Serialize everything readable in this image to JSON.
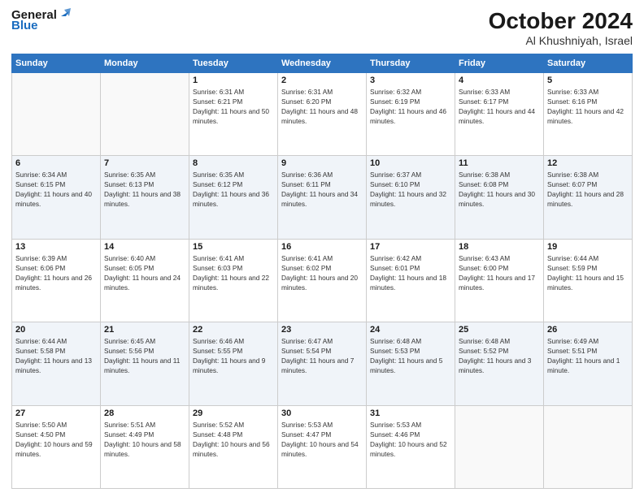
{
  "header": {
    "logo_general": "General",
    "logo_blue": "Blue",
    "month_title": "October 2024",
    "location": "Al Khushniyah, Israel"
  },
  "weekdays": [
    "Sunday",
    "Monday",
    "Tuesday",
    "Wednesday",
    "Thursday",
    "Friday",
    "Saturday"
  ],
  "weeks": [
    [
      {
        "day": "",
        "sunrise": "",
        "sunset": "",
        "daylight": ""
      },
      {
        "day": "",
        "sunrise": "",
        "sunset": "",
        "daylight": ""
      },
      {
        "day": "1",
        "sunrise": "Sunrise: 6:31 AM",
        "sunset": "Sunset: 6:21 PM",
        "daylight": "Daylight: 11 hours and 50 minutes."
      },
      {
        "day": "2",
        "sunrise": "Sunrise: 6:31 AM",
        "sunset": "Sunset: 6:20 PM",
        "daylight": "Daylight: 11 hours and 48 minutes."
      },
      {
        "day": "3",
        "sunrise": "Sunrise: 6:32 AM",
        "sunset": "Sunset: 6:19 PM",
        "daylight": "Daylight: 11 hours and 46 minutes."
      },
      {
        "day": "4",
        "sunrise": "Sunrise: 6:33 AM",
        "sunset": "Sunset: 6:17 PM",
        "daylight": "Daylight: 11 hours and 44 minutes."
      },
      {
        "day": "5",
        "sunrise": "Sunrise: 6:33 AM",
        "sunset": "Sunset: 6:16 PM",
        "daylight": "Daylight: 11 hours and 42 minutes."
      }
    ],
    [
      {
        "day": "6",
        "sunrise": "Sunrise: 6:34 AM",
        "sunset": "Sunset: 6:15 PM",
        "daylight": "Daylight: 11 hours and 40 minutes."
      },
      {
        "day": "7",
        "sunrise": "Sunrise: 6:35 AM",
        "sunset": "Sunset: 6:13 PM",
        "daylight": "Daylight: 11 hours and 38 minutes."
      },
      {
        "day": "8",
        "sunrise": "Sunrise: 6:35 AM",
        "sunset": "Sunset: 6:12 PM",
        "daylight": "Daylight: 11 hours and 36 minutes."
      },
      {
        "day": "9",
        "sunrise": "Sunrise: 6:36 AM",
        "sunset": "Sunset: 6:11 PM",
        "daylight": "Daylight: 11 hours and 34 minutes."
      },
      {
        "day": "10",
        "sunrise": "Sunrise: 6:37 AM",
        "sunset": "Sunset: 6:10 PM",
        "daylight": "Daylight: 11 hours and 32 minutes."
      },
      {
        "day": "11",
        "sunrise": "Sunrise: 6:38 AM",
        "sunset": "Sunset: 6:08 PM",
        "daylight": "Daylight: 11 hours and 30 minutes."
      },
      {
        "day": "12",
        "sunrise": "Sunrise: 6:38 AM",
        "sunset": "Sunset: 6:07 PM",
        "daylight": "Daylight: 11 hours and 28 minutes."
      }
    ],
    [
      {
        "day": "13",
        "sunrise": "Sunrise: 6:39 AM",
        "sunset": "Sunset: 6:06 PM",
        "daylight": "Daylight: 11 hours and 26 minutes."
      },
      {
        "day": "14",
        "sunrise": "Sunrise: 6:40 AM",
        "sunset": "Sunset: 6:05 PM",
        "daylight": "Daylight: 11 hours and 24 minutes."
      },
      {
        "day": "15",
        "sunrise": "Sunrise: 6:41 AM",
        "sunset": "Sunset: 6:03 PM",
        "daylight": "Daylight: 11 hours and 22 minutes."
      },
      {
        "day": "16",
        "sunrise": "Sunrise: 6:41 AM",
        "sunset": "Sunset: 6:02 PM",
        "daylight": "Daylight: 11 hours and 20 minutes."
      },
      {
        "day": "17",
        "sunrise": "Sunrise: 6:42 AM",
        "sunset": "Sunset: 6:01 PM",
        "daylight": "Daylight: 11 hours and 18 minutes."
      },
      {
        "day": "18",
        "sunrise": "Sunrise: 6:43 AM",
        "sunset": "Sunset: 6:00 PM",
        "daylight": "Daylight: 11 hours and 17 minutes."
      },
      {
        "day": "19",
        "sunrise": "Sunrise: 6:44 AM",
        "sunset": "Sunset: 5:59 PM",
        "daylight": "Daylight: 11 hours and 15 minutes."
      }
    ],
    [
      {
        "day": "20",
        "sunrise": "Sunrise: 6:44 AM",
        "sunset": "Sunset: 5:58 PM",
        "daylight": "Daylight: 11 hours and 13 minutes."
      },
      {
        "day": "21",
        "sunrise": "Sunrise: 6:45 AM",
        "sunset": "Sunset: 5:56 PM",
        "daylight": "Daylight: 11 hours and 11 minutes."
      },
      {
        "day": "22",
        "sunrise": "Sunrise: 6:46 AM",
        "sunset": "Sunset: 5:55 PM",
        "daylight": "Daylight: 11 hours and 9 minutes."
      },
      {
        "day": "23",
        "sunrise": "Sunrise: 6:47 AM",
        "sunset": "Sunset: 5:54 PM",
        "daylight": "Daylight: 11 hours and 7 minutes."
      },
      {
        "day": "24",
        "sunrise": "Sunrise: 6:48 AM",
        "sunset": "Sunset: 5:53 PM",
        "daylight": "Daylight: 11 hours and 5 minutes."
      },
      {
        "day": "25",
        "sunrise": "Sunrise: 6:48 AM",
        "sunset": "Sunset: 5:52 PM",
        "daylight": "Daylight: 11 hours and 3 minutes."
      },
      {
        "day": "26",
        "sunrise": "Sunrise: 6:49 AM",
        "sunset": "Sunset: 5:51 PM",
        "daylight": "Daylight: 11 hours and 1 minute."
      }
    ],
    [
      {
        "day": "27",
        "sunrise": "Sunrise: 5:50 AM",
        "sunset": "Sunset: 4:50 PM",
        "daylight": "Daylight: 10 hours and 59 minutes."
      },
      {
        "day": "28",
        "sunrise": "Sunrise: 5:51 AM",
        "sunset": "Sunset: 4:49 PM",
        "daylight": "Daylight: 10 hours and 58 minutes."
      },
      {
        "day": "29",
        "sunrise": "Sunrise: 5:52 AM",
        "sunset": "Sunset: 4:48 PM",
        "daylight": "Daylight: 10 hours and 56 minutes."
      },
      {
        "day": "30",
        "sunrise": "Sunrise: 5:53 AM",
        "sunset": "Sunset: 4:47 PM",
        "daylight": "Daylight: 10 hours and 54 minutes."
      },
      {
        "day": "31",
        "sunrise": "Sunrise: 5:53 AM",
        "sunset": "Sunset: 4:46 PM",
        "daylight": "Daylight: 10 hours and 52 minutes."
      },
      {
        "day": "",
        "sunrise": "",
        "sunset": "",
        "daylight": ""
      },
      {
        "day": "",
        "sunrise": "",
        "sunset": "",
        "daylight": ""
      }
    ]
  ]
}
